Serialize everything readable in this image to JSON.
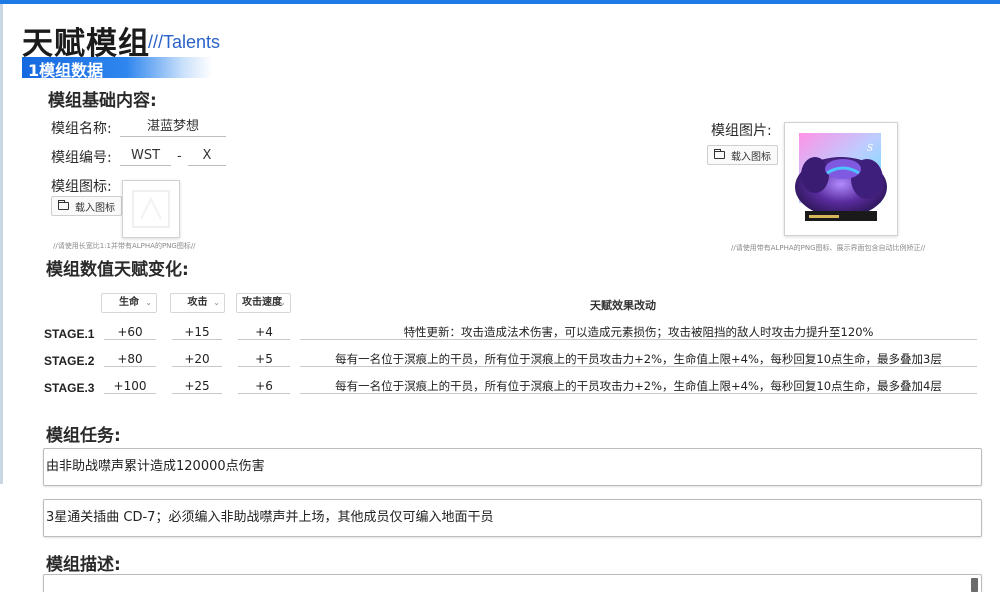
{
  "header": {
    "title": "天赋模组",
    "subtitle": "///Talents"
  },
  "section": {
    "label": "1模组数据"
  },
  "basic": {
    "heading": "模组基础内容:",
    "name_label": "模组名称:",
    "name_value": "湛蓝梦想",
    "id_label": "模组编号:",
    "id_prefix": "WST",
    "id_dash": "-",
    "id_suffix": "X",
    "icon_label": "模组图标:",
    "icon_load": "载入图标",
    "icon_hint": "//请使用长宽比1:1并带有ALPHA的PNG图标//",
    "image_label": "模组图片:",
    "image_load": "载入图标",
    "image_hint": "//请使用带有ALPHA的PNG图标、展示界面包含自动比例矫正//"
  },
  "talent": {
    "heading": "模组数值天赋变化:",
    "columns": [
      {
        "label": "生命"
      },
      {
        "label": "攻击"
      },
      {
        "label": "攻击速度"
      }
    ],
    "effect_header": "天赋效果改动",
    "rows": [
      {
        "stage": "STAGE.1",
        "hp": "+60",
        "atk": "+15",
        "spd": "+4",
        "effect": "特性更新：攻击造成法术伤害，可以造成元素损伤；攻击被阻挡的敌人时攻击力提升至120%"
      },
      {
        "stage": "STAGE.2",
        "hp": "+80",
        "atk": "+20",
        "spd": "+5",
        "effect": "每有一名位于溟痕上的干员，所有位于溟痕上的干员攻击力+2%，生命值上限+4%，每秒回复10点生命，最多叠加3层"
      },
      {
        "stage": "STAGE.3",
        "hp": "+100",
        "atk": "+25",
        "spd": "+6",
        "effect": "每有一名位于溟痕上的干员，所有位于溟痕上的干员攻击力+2%，生命值上限+4%，每秒回复10点生命，最多叠加4层"
      }
    ]
  },
  "mission": {
    "heading": "模组任务:",
    "tasks": [
      "由非助战噤声累计造成120000点伤害",
      "3星通关插曲 CD-7；必须编入非助战噤声并上场，其他成员仅可编入地面干员"
    ]
  },
  "description": {
    "heading": "模组描述:"
  },
  "colors": {
    "accent": "#1e7be6",
    "banner": "#1668e0"
  }
}
